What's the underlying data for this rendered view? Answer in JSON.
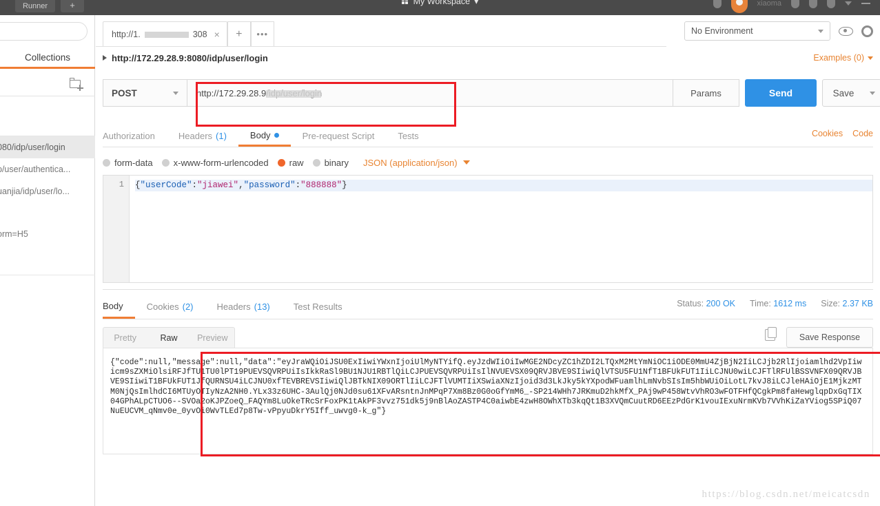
{
  "topbar": {
    "runner_label": "Runner",
    "new_label": "+",
    "workspace_title": "My Workspace",
    "workspace_caret": "▾",
    "username": "xiaoma"
  },
  "sidebar": {
    "search_placeholder": "",
    "tab_label": "Collections",
    "new_folder_icon": "folder-plus-icon",
    "items": [
      {
        "label": "080/idp/user/login",
        "selected": true
      },
      {
        "label": "p/user/authentica...",
        "selected": false
      },
      {
        "label": "uanjia/idp/user/lo...",
        "selected": false
      },
      {
        "label": "orm=H5",
        "selected": false
      }
    ]
  },
  "request_tabs": {
    "tab_prefix": "http://1.",
    "tab_suffix": "308",
    "close_label": "×",
    "new_tab_label": "+",
    "more_label": "•••"
  },
  "environment": {
    "selected": "No Environment",
    "eye_icon": "eye-icon",
    "gear_icon": "gear-icon"
  },
  "breadcrumb": {
    "label": "http://172.29.28.9:8080/idp/user/login"
  },
  "examples": {
    "label": "Examples (0)"
  },
  "url_row": {
    "method": "POST",
    "url_prefix": "http://",
    "url_middle": "172.29.28.9",
    "url_suffix": "/idp/user/login",
    "params_label": "Params",
    "send_label": "Send",
    "save_label": "Save"
  },
  "request_tabs_sub": {
    "items": [
      {
        "label": "Authorization",
        "count": "",
        "active": false,
        "dot": false
      },
      {
        "label": "Headers",
        "count": "(1)",
        "active": false,
        "dot": false
      },
      {
        "label": "Body",
        "count": "",
        "active": true,
        "dot": true
      },
      {
        "label": "Pre-request Script",
        "count": "",
        "active": false,
        "dot": false
      },
      {
        "label": "Tests",
        "count": "",
        "active": false,
        "dot": false
      }
    ],
    "cookies_label": "Cookies",
    "code_label": "Code"
  },
  "body_types": {
    "options": [
      {
        "label": "form-data",
        "selected": false
      },
      {
        "label": "x-www-form-urlencoded",
        "selected": false
      },
      {
        "label": "raw",
        "selected": true
      },
      {
        "label": "binary",
        "selected": false
      }
    ],
    "content_type": "JSON (application/json)"
  },
  "editor": {
    "line_number": "1",
    "tokens": [
      {
        "t": "{",
        "c": "punc"
      },
      {
        "t": "\"userCode\"",
        "c": "key"
      },
      {
        "t": ":",
        "c": "punc"
      },
      {
        "t": "\"jiawei\"",
        "c": "str"
      },
      {
        "t": ",",
        "c": "punc"
      },
      {
        "t": "\"password\"",
        "c": "key"
      },
      {
        "t": ":",
        "c": "punc"
      },
      {
        "t": "\"888888\"",
        "c": "str"
      },
      {
        "t": "}",
        "c": "punc"
      }
    ],
    "raw": "{\"userCode\":\"jiawei\",\"password\":\"888888\"}"
  },
  "response": {
    "tabs": [
      {
        "label": "Body",
        "count": "",
        "active": true
      },
      {
        "label": "Cookies",
        "count": "(2)",
        "active": false
      },
      {
        "label": "Headers",
        "count": "(13)",
        "active": false
      },
      {
        "label": "Test Results",
        "count": "",
        "active": false
      }
    ],
    "status_label": "Status:",
    "status_value": "200 OK",
    "time_label": "Time:",
    "time_value": "1612 ms",
    "size_label": "Size:",
    "size_value": "2.37 KB",
    "view_modes": [
      {
        "label": "Pretty",
        "active": false
      },
      {
        "label": "Raw",
        "active": true
      },
      {
        "label": "Preview",
        "active": false
      }
    ],
    "copy_icon": "copy-icon",
    "save_response_label": "Save Response",
    "body_text": "{\"code\":null,\"message\":null,\"data\":\"eyJraWQiOiJSU0ExIiwiYWxnIjoiUlMyNTYifQ.eyJzdWIiOiIwMGE2NDcyZC1hZDI2LTQxM2MtYmNiOC1iODE0MmU4ZjBjN2IiLCJjb2RlIjoiamlhd2VpIiwicm9sZXMiOlsiRFJfTU1TU0lPT19PUEVSQVRPUiIsIkkRaSl9BU1NJU1RBTlQiLCJPUEVSQVRPUiIsIlNVUEVSX09QRVJBVE9SIiwiQlVTSU5FU1NfT1BFUkFUT1IiLCJNU0wiLCJFTlRFUlBSSVNFX09QRVJBVE9SIiwiT1BFUkFUT1JfQURNSU4iLCJNU0xfTEVBREVSIiwiQlJBTkNIX09ORTlIiLCJFTlVUMTIiXSwiaXNzIjoid3d3LkJky5kYXpodWFuamlhLmNvbSIsIm5hbWUiOiLotL7kvJ8iLCJleHAiOjE1MjkzMTM0NjQsImlhdCI6MTUyOTIyNzA2NH0.YLx33z6UHC-3AulQj0NJd0su61XFvARsntnJnMPqP7Xm8Bz0G0oGfYmM6_-SP214WHh7JRKmuD2hkMfX_PAj9wP458WtvVhRO3wFOTFHfQCgkPm8faHewglqpDxGqTIX04GPhALpCTUO6--SVOa2oKJPZoeQ_FAQYm8LuOkeTRcSrFoxPK1tAkPF3vvz751dk5j9nBlAoZASTP4C0aiwbE4zwH8OWhXTb3kqQt1B3XVQmCuutRD6EEzPdGrK1vouIExuNrmKVb7VVhKiZaYViog5SPiQ07NuEUCVM_qNmv0e_0yvOi0WvTLEd7p8Tw-vPpyuDkrY5Iff_uwvg0-k_g\"}"
  },
  "watermark": "https://blog.csdn.net/meicatcsdn"
}
